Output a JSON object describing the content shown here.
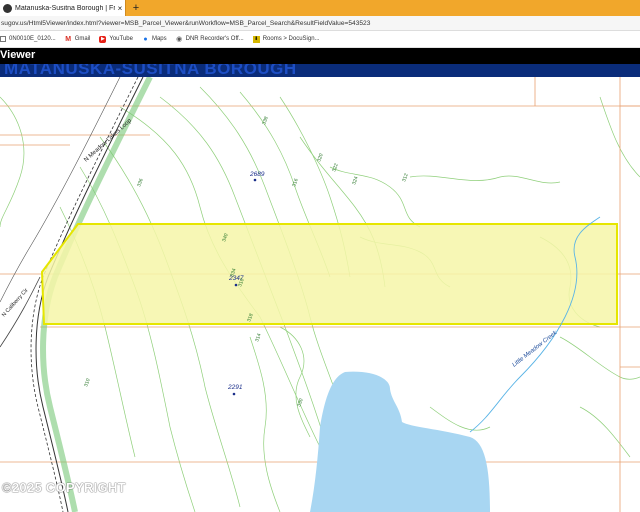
{
  "browser": {
    "tab_title": "Matanuska-Susitna Borough | Fr",
    "tab_close": "×",
    "new_tab": "+",
    "url": "sugov.us/Html5Viewer/index.html?viewer=MSB_Parcel_Viewer&runWorkflow=MSB_Parcel_Search&ResultFieldValue=543523",
    "bookmarks": [
      {
        "icon": "bookmark-icon",
        "label": "0N0010E_0120..."
      },
      {
        "icon": "gmail-icon",
        "label": "Gmail"
      },
      {
        "icon": "youtube-icon",
        "label": "YouTube"
      },
      {
        "icon": "maps-pin-icon",
        "label": "Maps"
      },
      {
        "icon": "dnr-icon",
        "label": "DNR Recorder's Off..."
      },
      {
        "icon": "docusign-icon",
        "label": "Rooms > DocuSign..."
      }
    ]
  },
  "app": {
    "title": "Viewer",
    "banner": "MATANUSKA-SUSITNA BOROUGH"
  },
  "map": {
    "parcel_labels": [
      "2689",
      "2347",
      "2291"
    ],
    "contour_labels": [
      "336",
      "334",
      "338",
      "320",
      "322",
      "324",
      "316",
      "318",
      "314",
      "312",
      "310",
      "330",
      "332",
      "326",
      "328",
      "340"
    ],
    "road_labels": [
      "N Meadow Lakes Loop",
      "N Caliberry Cir"
    ],
    "creek_label": "Little Meadow Creek",
    "highlight_color": "#f6f6a8",
    "outline_color": "#e6e600",
    "water_color": "#a8d6f2",
    "contour_color": "#8fcf7a",
    "parcel_line_color": "#e8a070"
  },
  "watermark": "©2025 COPYRIGHT"
}
